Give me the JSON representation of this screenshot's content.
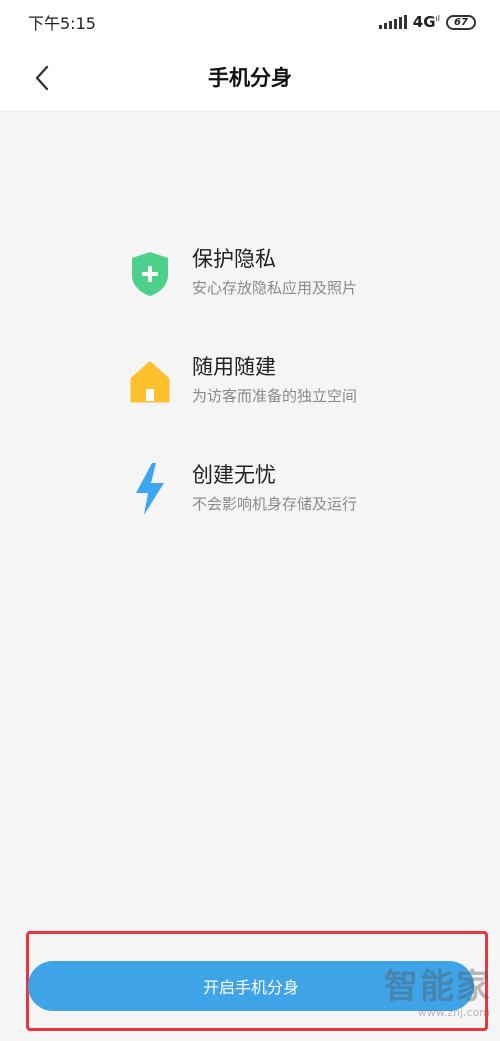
{
  "status_bar": {
    "time": "下午5:15",
    "network": "4G",
    "network_sub": "ıl",
    "battery": "67"
  },
  "header": {
    "title": "手机分身"
  },
  "features": [
    {
      "icon": "shield-plus-icon",
      "color": "#4cd08a",
      "title": "保护隐私",
      "description": "安心存放隐私应用及照片"
    },
    {
      "icon": "house-icon",
      "color": "#ffc02e",
      "title": "随用随建",
      "description": "为访客而准备的独立空间"
    },
    {
      "icon": "lightning-icon",
      "color": "#3da6f2",
      "title": "创建无忧",
      "description": "不会影响机身存储及运行"
    }
  ],
  "action": {
    "button_label": "开启手机分身",
    "button_color": "#3ea3e7",
    "highlight_color": "#e8373e"
  },
  "watermark": {
    "logo": "智能家",
    "url": "www.znj.com"
  }
}
